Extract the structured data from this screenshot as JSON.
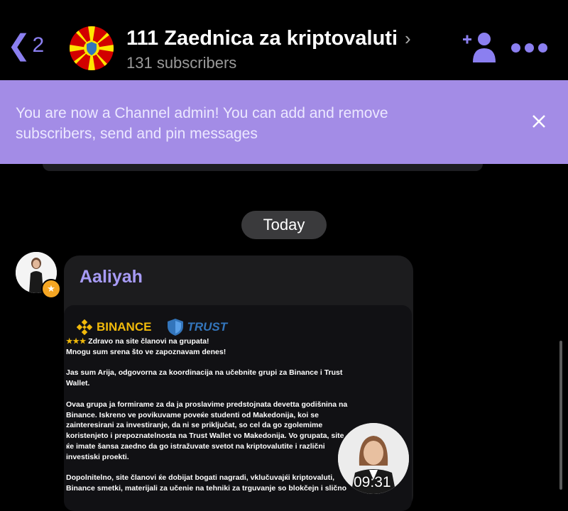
{
  "header": {
    "back_count": "2",
    "channel_title": "111 Zaednica za kriptovaluti",
    "subscribers": "131 subscribers"
  },
  "banner": {
    "text": "You are now a Channel admin! You can add and remove subscribers, send and pin messages"
  },
  "chat": {
    "date_label": "Today",
    "message": {
      "sender": "Aaliyah",
      "logos": {
        "binance": "BINANCE",
        "trust": "TRUST"
      },
      "body": "Zdravo na site članovi na grupata!\nMnogu sum srena što ve zapoznavam denes!\n\nJas sum Arija, odgovorna za koordinacija na učebnite grupi za Binance i Trust Wallet.\n\nOvaa grupa ja formirame za da ja proslavime predstojnata devetta godišnina na Binance. Iskreno ve povikuvame poveќe studenti od Makedonija, koi se zainteresirani za investiranje, da ni se priključat, so cel da go zgolemime koristenjeto i prepoznatelnosta na Trust Wallet vo Makedonija. Vo grupata, site ќe imate šansa zaedno da go istražuvate svetot na kriptovalutite i različni investiski proekti.\n\nDopolnitelno, site članovi ќe dobijat bogati nagradi, vklučuvajќi kriptovaluti, Binance smetki, materijali za učenie na tehniki za trguvanje so blokčejn i slično",
      "stars": "★★★",
      "time": "09:31"
    }
  },
  "colors": {
    "accent": "#8b7ff0",
    "banner_bg": "#a38ce6",
    "sender_name": "#a79bf5",
    "binance": "#f0b90b",
    "trust": "#3375bb"
  }
}
